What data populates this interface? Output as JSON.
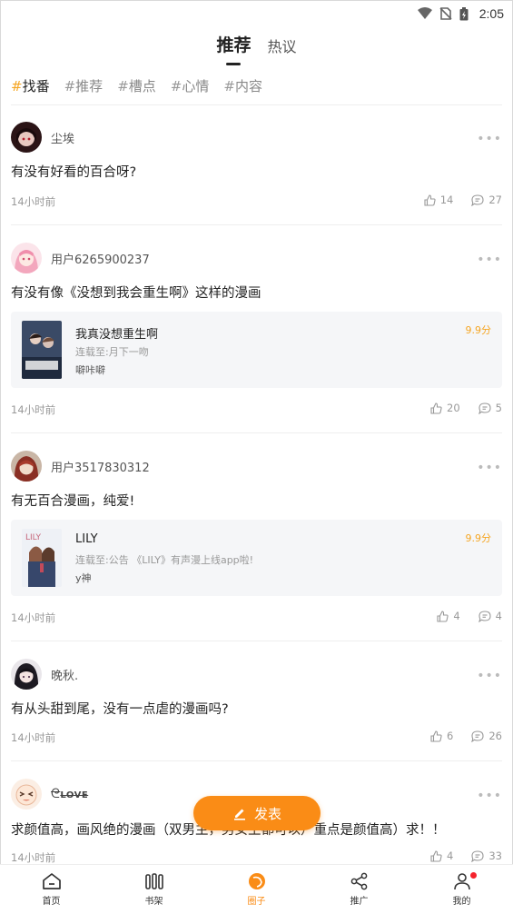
{
  "status_bar": {
    "time": "2:05"
  },
  "top_tabs": [
    {
      "label": "推荐",
      "active": true
    },
    {
      "label": "热议",
      "active": false
    }
  ],
  "topics": [
    {
      "hash": "#",
      "label": "找番",
      "active": true
    },
    {
      "hash": "#",
      "label": "推荐",
      "active": false
    },
    {
      "hash": "#",
      "label": "槽点",
      "active": false
    },
    {
      "hash": "#",
      "label": "心情",
      "active": false
    },
    {
      "hash": "#",
      "label": "内容",
      "active": false
    }
  ],
  "posts": [
    {
      "username": "尘埃",
      "text": "有没有好看的百合呀?",
      "time": "14小时前",
      "likes": "14",
      "comments": "27"
    },
    {
      "username": "用户6265900237",
      "text": "有没有像《没想到我会重生啊》这样的漫画",
      "time": "14小时前",
      "likes": "20",
      "comments": "5",
      "book": {
        "title": "我真没想重生啊",
        "progress": "连载至:月下一吻",
        "author": "噼咔噼",
        "score": "9.9分"
      }
    },
    {
      "username": "用户3517830312",
      "text": "有无百合漫画，纯爱!",
      "time": "14小时前",
      "likes": "4",
      "comments": "4",
      "book": {
        "title": "LILY",
        "progress": "连载至:公告 《LILY》有声漫上线app啦!",
        "author": "y神",
        "score": "9.9分"
      }
    },
    {
      "username": "晚秋.",
      "text": "有从头甜到尾，没有一点虐的漫画吗?",
      "time": "14小时前",
      "likes": "6",
      "comments": "26"
    },
    {
      "username": "LOVE",
      "text": "求颜值高，画风绝的漫画（双男主，男女主都可以）重点是颜值高）求！！",
      "time": "14小时前",
      "likes": "4",
      "comments": "33"
    }
  ],
  "fab": {
    "label": "发表"
  },
  "bottom_nav": [
    {
      "label": "首页",
      "icon": "home-icon",
      "active": false
    },
    {
      "label": "书架",
      "icon": "bookshelf-icon",
      "active": false
    },
    {
      "label": "圈子",
      "icon": "circle-icon",
      "active": true
    },
    {
      "label": "推广",
      "icon": "share-icon",
      "active": false
    },
    {
      "label": "我的",
      "icon": "profile-icon",
      "active": false
    }
  ],
  "colors": {
    "accent": "#fa8c16",
    "score": "#f5a623",
    "badge": "#f5222d"
  }
}
